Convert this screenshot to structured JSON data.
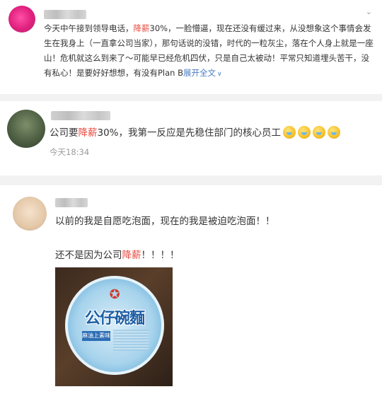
{
  "post1": {
    "text_a": "今天中午接到领导电话，",
    "text_hl": "降薪",
    "text_b": "30%，一脸懵逼，现在还没有缓过来，从没想象这个事情会发生在我身上（一直拿公司当家），那句话说的没错，时代的一粒灰尘，落在个人身上就是一座山！危机就这么到来了～可能早已经危机四伏，只是自己太被动！平常只知道埋头苦干，没有私心！是要好好想想，有没有Plan B",
    "expand": "展开全文",
    "expand_icon": "chevron-down-icon"
  },
  "comment1": {
    "text_a": "公司要",
    "text_hl": "降薪",
    "text_b": "30%，我第一反应是先稳住部门的核心员工",
    "emoji_count": 4,
    "time": "今天18:34"
  },
  "comment2": {
    "line1": "以前的我是自愿吃泡面，现在的我是被迫吃泡面！！",
    "line2_a": "还不是因为公司",
    "line2_hl": "降薪",
    "line2_b": "！！！！",
    "image_title": "公仔碗麵",
    "image_label": "麻油上素味"
  },
  "colors": {
    "highlight": "#e8483d",
    "link": "#4a7cc2",
    "muted": "#9a9a9a"
  }
}
